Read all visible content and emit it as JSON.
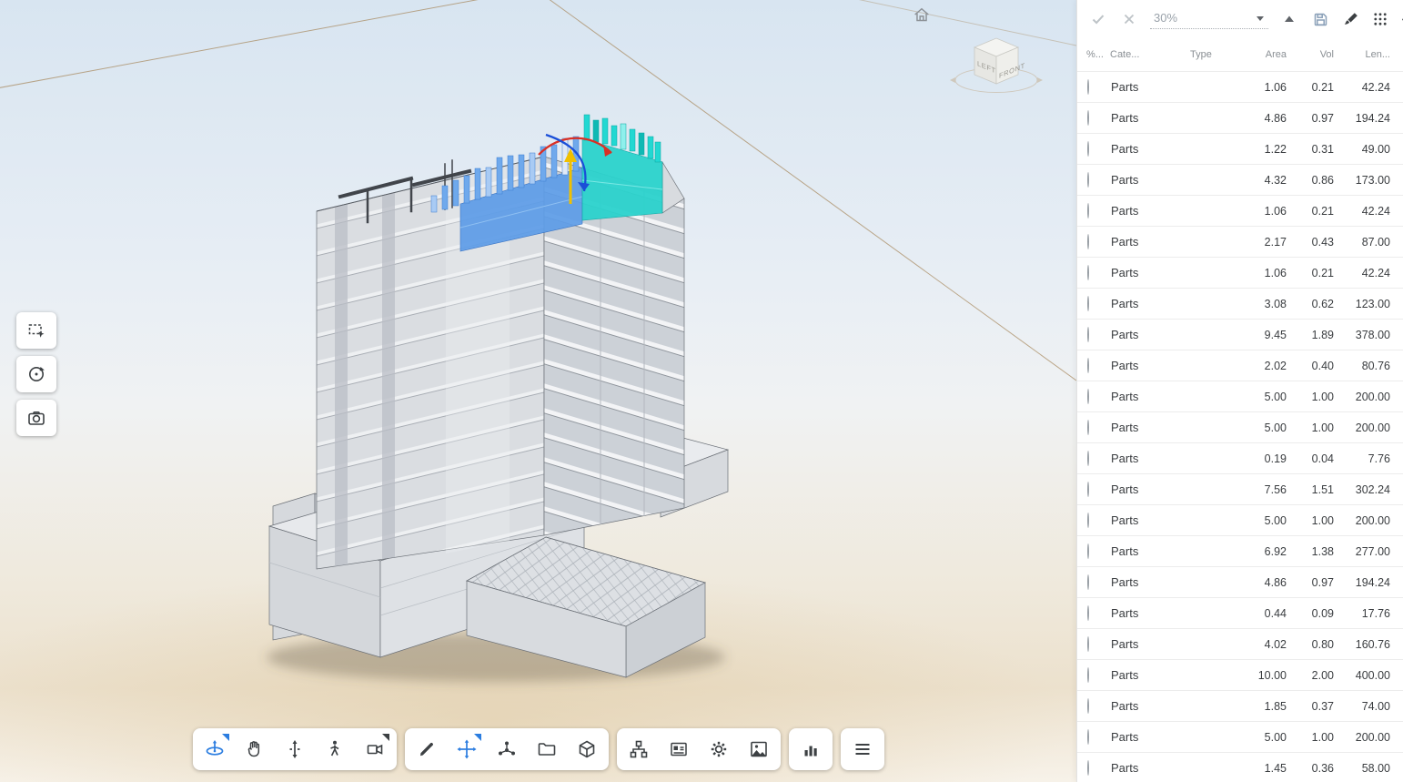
{
  "viewport": {
    "cube": {
      "left": "LEFT",
      "front": "FRONT"
    },
    "gizmo_colors": {
      "x_arc": "#d93025",
      "y_arc": "#1b4fd8",
      "up_arrow": "#f0c000"
    },
    "highlight_colors": {
      "selected_blue": "#5e9de8",
      "selected_teal": "#2bd3cd"
    }
  },
  "left_toolbar": {
    "items": [
      {
        "icon": "marquee-zoom-icon"
      },
      {
        "icon": "orbit-icon"
      },
      {
        "icon": "snapshot-icon"
      }
    ]
  },
  "bottom_toolbar": {
    "active_color": "#2b7de0",
    "groups": [
      {
        "items": [
          "orbit-tool",
          "pan-tool",
          "elevation-tool",
          "walk-tool",
          "camera-views"
        ],
        "active": "orbit-tool"
      },
      {
        "items": [
          "markup-tool",
          "move-tool",
          "explode-tool",
          "files-tool",
          "models-tool"
        ],
        "active": "move-tool"
      },
      {
        "items": [
          "structure-tool",
          "properties-tool",
          "settings-tool",
          "render-tool"
        ],
        "active": null
      },
      {
        "items": [
          "reports-tool"
        ],
        "active": null
      },
      {
        "items": [
          "main-menu"
        ],
        "active": null
      }
    ]
  },
  "right_panel": {
    "toolbar": {
      "percent_value": "30%",
      "icons": [
        "confirm",
        "cancel",
        "percent-dropdown",
        "collapse-up",
        "save",
        "paint",
        "grid-dots",
        "visibility"
      ]
    },
    "table": {
      "columns": [
        "%...",
        "Cate...",
        "Type",
        "Area",
        "Vol",
        "Len..."
      ],
      "rows": [
        {
          "category": "Parts",
          "area": "1.06",
          "vol": "0.21",
          "len": "42.24"
        },
        {
          "category": "Parts",
          "area": "4.86",
          "vol": "0.97",
          "len": "194.24"
        },
        {
          "category": "Parts",
          "area": "1.22",
          "vol": "0.31",
          "len": "49.00"
        },
        {
          "category": "Parts",
          "area": "4.32",
          "vol": "0.86",
          "len": "173.00"
        },
        {
          "category": "Parts",
          "area": "1.06",
          "vol": "0.21",
          "len": "42.24"
        },
        {
          "category": "Parts",
          "area": "2.17",
          "vol": "0.43",
          "len": "87.00"
        },
        {
          "category": "Parts",
          "area": "1.06",
          "vol": "0.21",
          "len": "42.24"
        },
        {
          "category": "Parts",
          "area": "3.08",
          "vol": "0.62",
          "len": "123.00"
        },
        {
          "category": "Parts",
          "area": "9.45",
          "vol": "1.89",
          "len": "378.00"
        },
        {
          "category": "Parts",
          "area": "2.02",
          "vol": "0.40",
          "len": "80.76"
        },
        {
          "category": "Parts",
          "area": "5.00",
          "vol": "1.00",
          "len": "200.00"
        },
        {
          "category": "Parts",
          "area": "5.00",
          "vol": "1.00",
          "len": "200.00"
        },
        {
          "category": "Parts",
          "area": "0.19",
          "vol": "0.04",
          "len": "7.76"
        },
        {
          "category": "Parts",
          "area": "7.56",
          "vol": "1.51",
          "len": "302.24"
        },
        {
          "category": "Parts",
          "area": "5.00",
          "vol": "1.00",
          "len": "200.00"
        },
        {
          "category": "Parts",
          "area": "6.92",
          "vol": "1.38",
          "len": "277.00"
        },
        {
          "category": "Parts",
          "area": "4.86",
          "vol": "0.97",
          "len": "194.24"
        },
        {
          "category": "Parts",
          "area": "0.44",
          "vol": "0.09",
          "len": "17.76"
        },
        {
          "category": "Parts",
          "area": "4.02",
          "vol": "0.80",
          "len": "160.76"
        },
        {
          "category": "Parts",
          "area": "10.00",
          "vol": "2.00",
          "len": "400.00"
        },
        {
          "category": "Parts",
          "area": "1.85",
          "vol": "0.37",
          "len": "74.00"
        },
        {
          "category": "Parts",
          "area": "5.00",
          "vol": "1.00",
          "len": "200.00"
        },
        {
          "category": "Parts",
          "area": "1.45",
          "vol": "0.36",
          "len": "58.00"
        }
      ]
    }
  }
}
